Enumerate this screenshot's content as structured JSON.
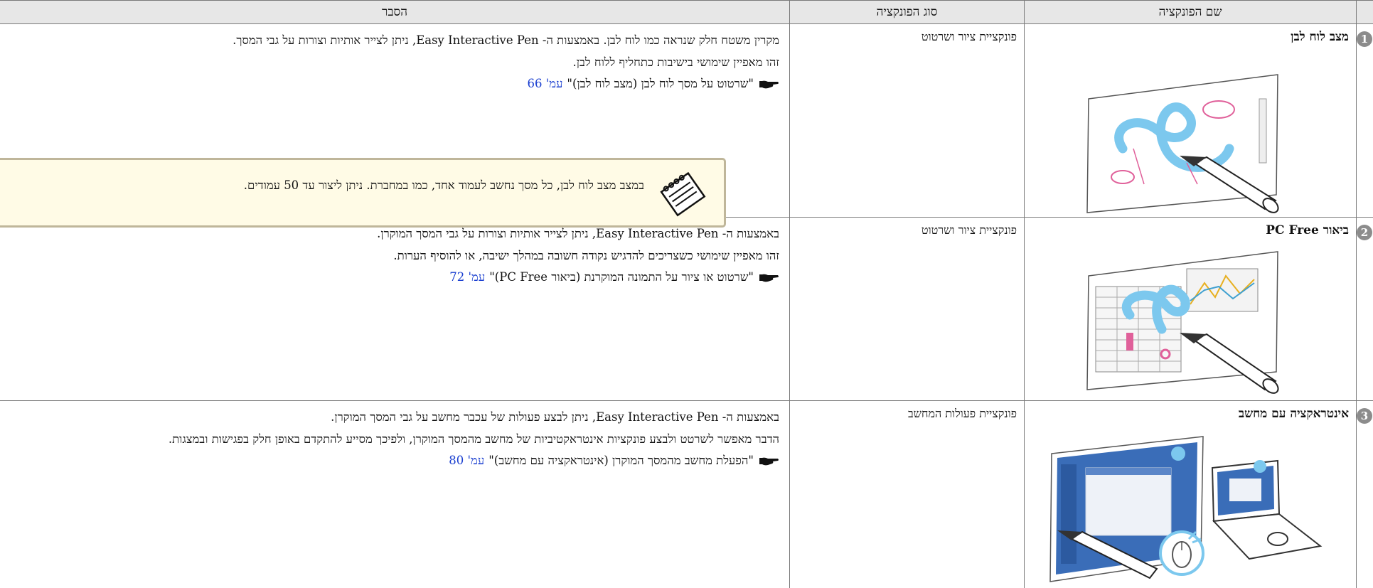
{
  "header": {
    "col_name": "שם הפונקציה",
    "col_type": "סוג הפונקציה",
    "col_desc": "הסבר"
  },
  "rows": [
    {
      "num": "1",
      "name": "מצב לוח לבן",
      "type": "פונקציית ציור ושרטוט",
      "lines": [
        "מקרין משטח חלק שנראה כמו לוח לבן. באמצעות ה- Easy Interactive Pen, ניתן לצייר אותיות וצורות על גבי המסך.",
        "זהו מאפיין שימושי בישיבות כתחליף ללוח לבן."
      ],
      "ref_text": "\"שרטוט על מסך לוח לבן (מצב לוח לבן)\"",
      "ref_link": "עמ' 66",
      "note": "במצב מצב לוח לבן, כל מסך נחשב לעמוד אחד, כמו במחברת. ניתן ליצור עד 50 עמודים."
    },
    {
      "num": "2",
      "name": "ביאור PC Free",
      "type": "פונקציית ציור ושרטוט",
      "lines": [
        "באמצעות ה- Easy Interactive Pen, ניתן לצייר אותיות וצורות על גבי המסך המוקרן.",
        "זהו מאפיין שימושי כשצריכים להדגיש נקודה חשובה במהלך ישיבה, או להוסיף הערות."
      ],
      "ref_text": "\"שרטוט או ציור על התמונה המוקרנת (ביאור PC Free)\"",
      "ref_link": "עמ' 72"
    },
    {
      "num": "3",
      "name": "אינטראקציה עם מחשב",
      "type": "פונקציית פעולות המחשב",
      "lines": [
        "באמצעות ה- Easy Interactive Pen, ניתן לבצע פעולות של עכבר מחשב על גבי המסך המוקרן.",
        "הדבר מאפשר לשרטט ולבצע פונקציות אינטראקטיביות של מחשב מהמסך המוקרן, ולפיכך מסייע להתקדם באופן חלק בפגישות ובמצגות."
      ],
      "ref_text": "\"הפעלת מחשב מהמסך המוקרן (אינטראקציה עם מחשב)\"",
      "ref_link": "עמ' 80"
    }
  ],
  "colors": {
    "link": "#1a3fd0",
    "header_bg": "#e7e7e7",
    "note_bg": "#fffbe6",
    "pen_blue": "#7cc8ee"
  },
  "icons": {
    "ref": "pointing-hand-icon",
    "note": "notepad-icon"
  }
}
